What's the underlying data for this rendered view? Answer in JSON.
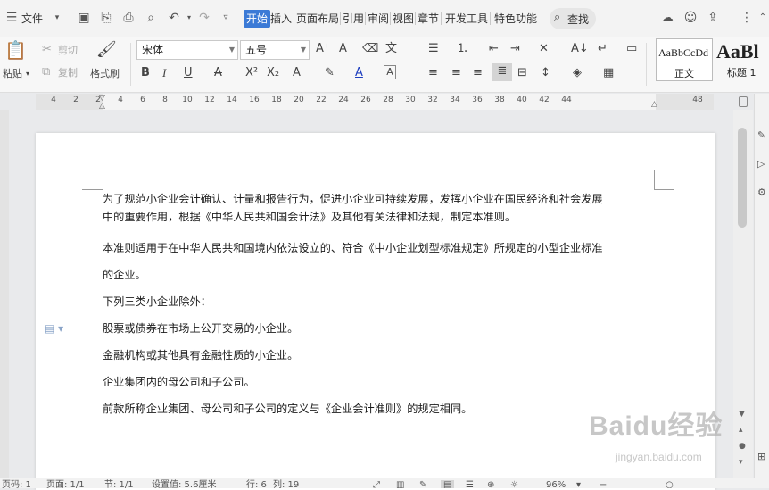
{
  "topbar": {
    "file_menu": "文件",
    "tabs": [
      "开始",
      "插入",
      "页面布局",
      "引用",
      "审阅",
      "视图",
      "章节",
      "开发工具",
      "特色功能"
    ],
    "active_tab": "开始",
    "search_label": "查找"
  },
  "ribbon": {
    "paste": "粘贴",
    "cut": "剪切",
    "copy": "复制",
    "format_painter": "格式刷",
    "font_name": "宋体",
    "font_size": "五号",
    "styles": [
      {
        "preview": "AaBbCcDd",
        "label": "正文"
      },
      {
        "preview": "AaBl",
        "label": "标题 1"
      }
    ]
  },
  "ruler": {
    "labels": [
      "4",
      "2",
      "2",
      "4",
      "6",
      "8",
      "10",
      "12",
      "14",
      "16",
      "18",
      "20",
      "22",
      "24",
      "26",
      "28",
      "30",
      "32",
      "34",
      "36",
      "38",
      "40",
      "42",
      "44",
      "48"
    ]
  },
  "document": {
    "paragraphs": [
      "为了规范小企业会计确认、计量和报告行为，促进小企业可持续发展，发挥小企业在国民经济和社会发展",
      "中的重要作用，根据《中华人民共和国会计法》及其他有关法律和法规，制定本准则。",
      "本准则适用于在中华人民共和国境内依法设立的、符合《中小企业划型标准规定》所规定的小型企业标准",
      "的企业。",
      "下列三类小企业除外：",
      "股票或债券在市场上公开交易的小企业。",
      "金融机构或其他具有金融性质的小企业。",
      "企业集团内的母公司和子公司。",
      "前款所称企业集团、母公司和子公司的定义与《企业会计准则》的规定相同。"
    ]
  },
  "statusbar": {
    "page_num": "页码: 1",
    "page": "页面: 1/1",
    "section": "节: 1/1",
    "setting": "设置值: 5.6厘米",
    "row": "行: 6",
    "col": "列: 19",
    "zoom": "96%"
  },
  "watermark": {
    "main": "Baidu经验",
    "sub": "jingyan.baidu.com"
  }
}
